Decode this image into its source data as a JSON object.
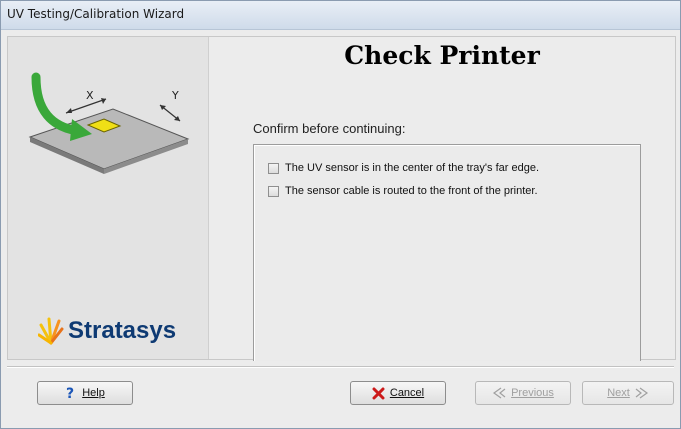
{
  "window": {
    "title": "UV Testing/Calibration Wizard"
  },
  "illustration": {
    "axis_x": "X",
    "axis_y": "Y"
  },
  "logo": {
    "text": "Stratasys"
  },
  "main": {
    "heading": "Check Printer",
    "subheading": "Confirm before continuing:",
    "checklist": [
      {
        "label": "The UV sensor is in the center of the tray's far edge.",
        "checked": false
      },
      {
        "label": "The sensor cable is routed to the front of the printer.",
        "checked": false
      }
    ]
  },
  "buttons": {
    "help": "Help",
    "cancel": "Cancel",
    "previous": "Previous",
    "next": "Next"
  },
  "colors": {
    "accent_arrow": "#3aa83a",
    "cancel_x": "#cc1a1a",
    "help_icon": "#1b56b8",
    "logo_text": "#0e3a73"
  }
}
